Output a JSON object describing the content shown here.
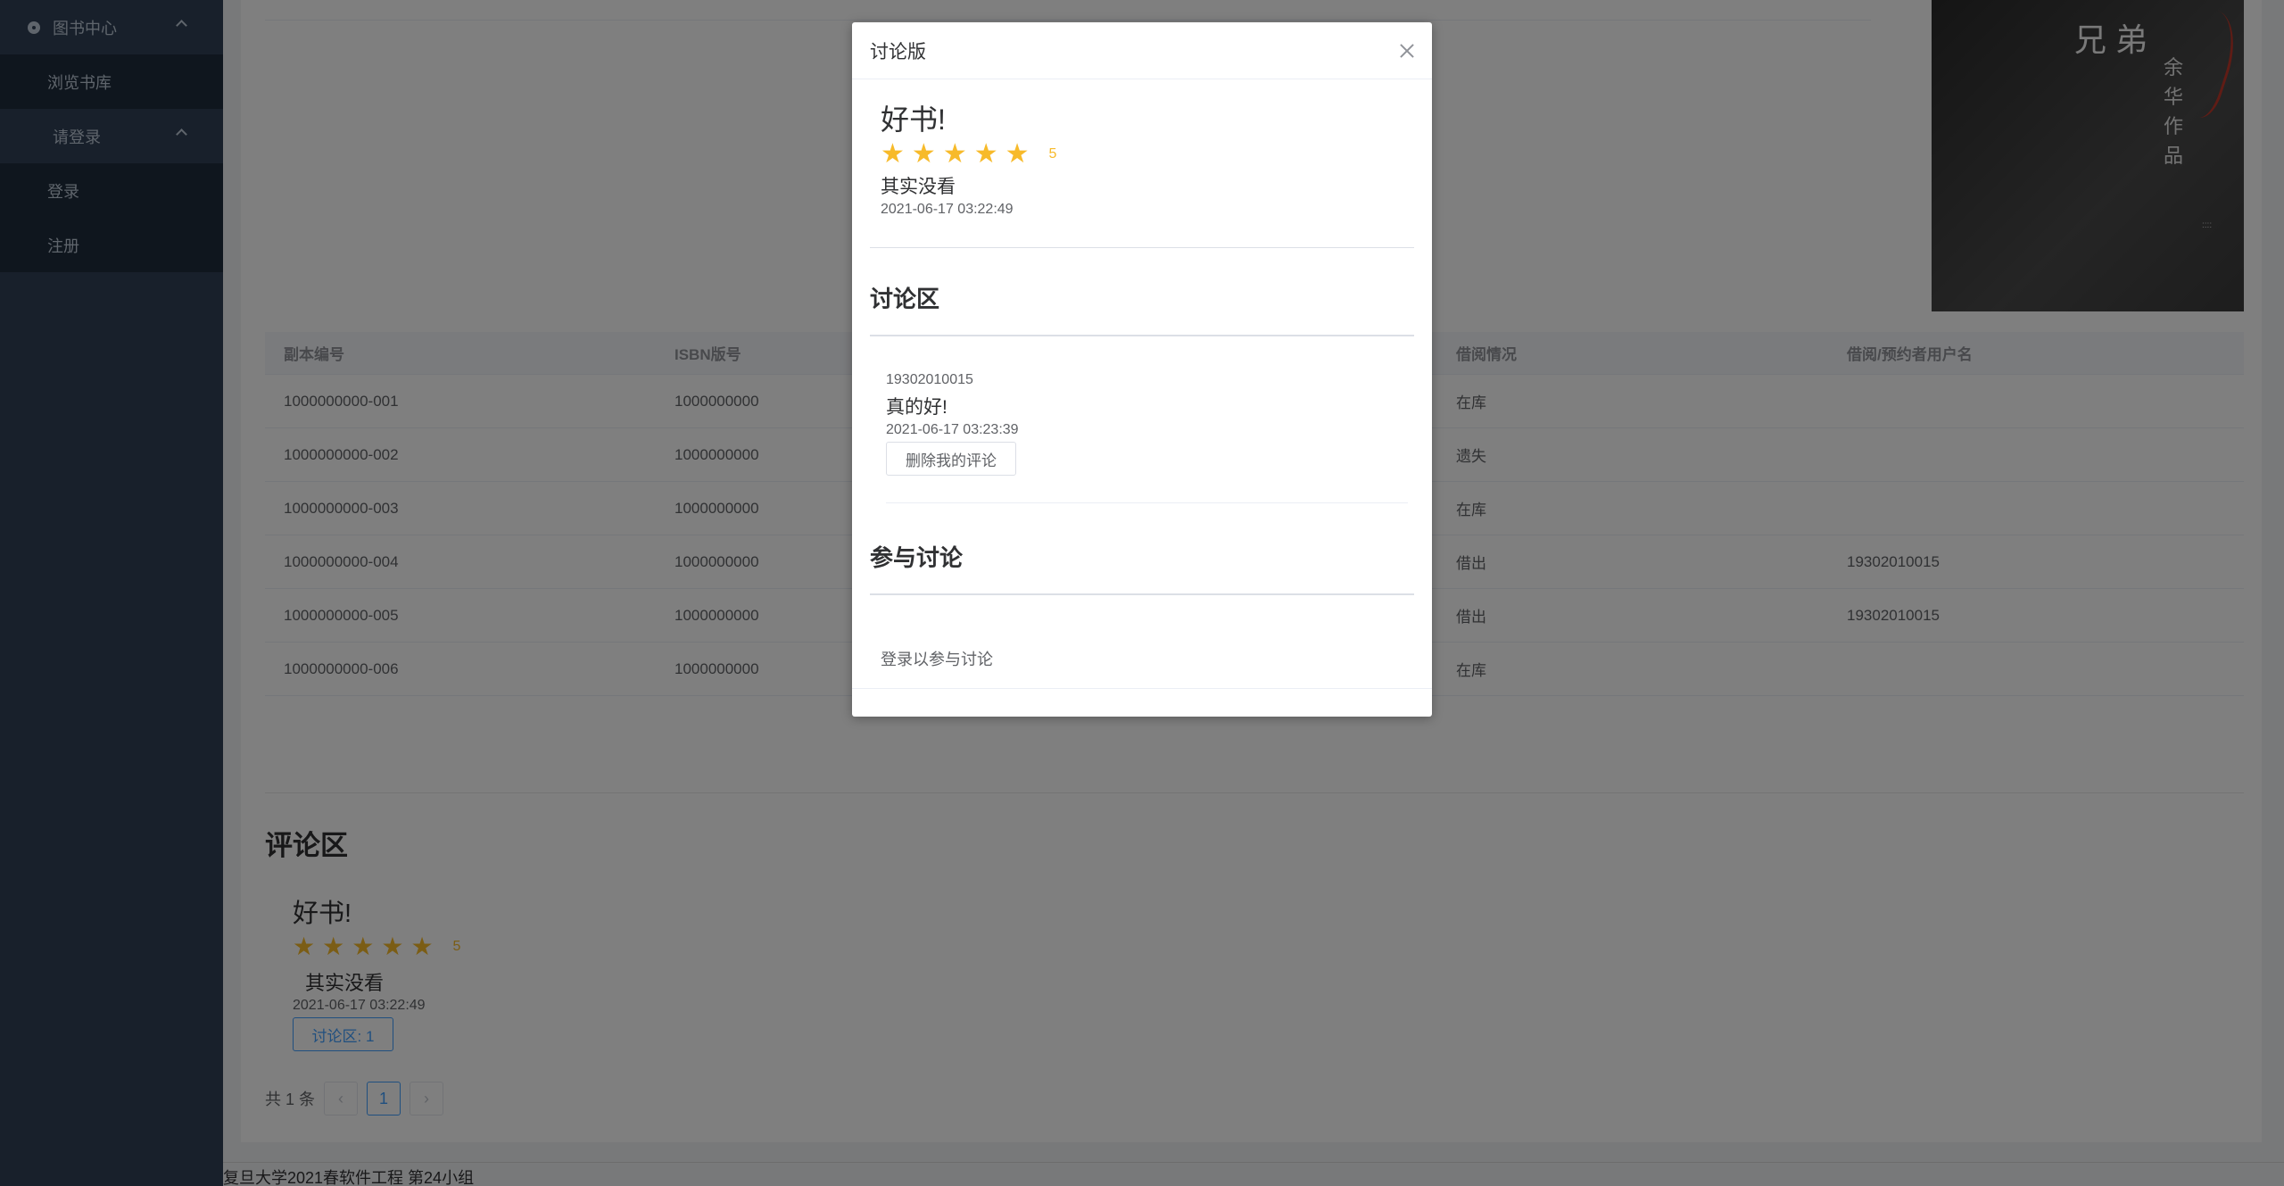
{
  "sidebar": {
    "group1": {
      "title": "图书中心",
      "items": [
        "浏览书库"
      ]
    },
    "group2": {
      "title": "请登录",
      "items": [
        "登录",
        "注册"
      ]
    }
  },
  "book_cover": {
    "title": "兄弟",
    "author_line": "余华作品"
  },
  "table": {
    "headers": [
      "副本编号",
      "ISBN版号",
      "",
      "借阅情况",
      "借阅/预约者用户名"
    ],
    "rows": [
      [
        "1000000000-001",
        "1000000000",
        "",
        "在库",
        ""
      ],
      [
        "1000000000-002",
        "1000000000",
        "",
        "遗失",
        ""
      ],
      [
        "1000000000-003",
        "1000000000",
        "",
        "在库",
        ""
      ],
      [
        "1000000000-004",
        "1000000000",
        "",
        "借出",
        "19302010015"
      ],
      [
        "1000000000-005",
        "1000000000",
        "",
        "借出",
        "19302010015"
      ],
      [
        "1000000000-006",
        "1000000000",
        "",
        "在库",
        ""
      ]
    ]
  },
  "reviews": {
    "section_title": "评论区",
    "items": [
      {
        "title": "好书!",
        "rating": 5,
        "rating_label": "5",
        "body": "其实没看",
        "date": "2021-06-17 03:22:49",
        "discussion_button": "讨论区: 1"
      }
    ]
  },
  "pagination": {
    "total_label": "共 1 条",
    "current_page": "1",
    "prev": "‹",
    "next": "›"
  },
  "footer": {
    "text": "复旦大学2021春软件工程 第24小组"
  },
  "dialog": {
    "title": "讨论版",
    "review": {
      "title": "好书!",
      "rating": 5,
      "rating_label": "5",
      "body": "其实没看",
      "date": "2021-06-17 03:22:49"
    },
    "discussion_heading": "讨论区",
    "comments": [
      {
        "user": "19302010015",
        "text": "真的好!",
        "date": "2021-06-17 03:23:39",
        "delete_label": "删除我的评论"
      }
    ],
    "join_heading": "参与讨论",
    "login_prompt": "登录以参与讨论"
  },
  "colors": {
    "sidebar_bg": "#304156",
    "star": "#f7ba2a",
    "accent": "#409eff"
  }
}
